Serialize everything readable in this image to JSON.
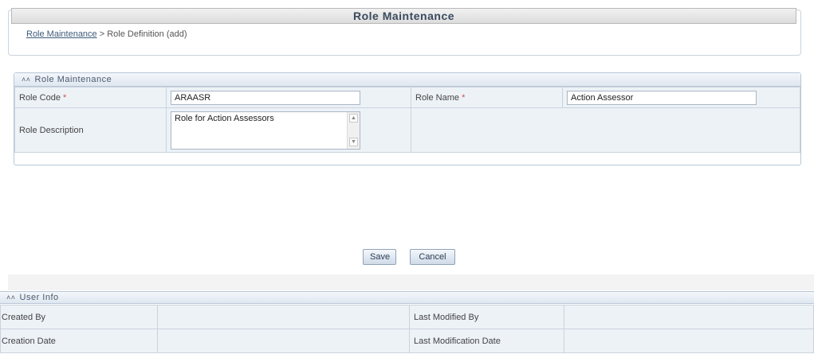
{
  "header": {
    "title": "Role Maintenance"
  },
  "breadcrumb": {
    "link": "Role Maintenance",
    "separator": ">",
    "current": "Role Definition (add)"
  },
  "role_panel": {
    "section_title": "Role Maintenance",
    "role_code_label": "Role Code",
    "role_code_value": "ARAASR",
    "role_name_label": "Role Name",
    "role_name_value": "Action Assessor",
    "role_description_label": "Role Description",
    "role_description_value": "Role for Action Assessors",
    "required_marker": "*"
  },
  "actions": {
    "save_label": "Save",
    "cancel_label": "Cancel"
  },
  "user_info": {
    "section_title": "User Info",
    "created_by_label": "Created By",
    "created_by_value": "",
    "last_modified_by_label": "Last Modified By",
    "last_modified_by_value": "",
    "creation_date_label": "Creation Date",
    "creation_date_value": "",
    "last_modification_date_label": "Last Modification Date",
    "last_modification_date_value": ""
  },
  "icons": {
    "collapse": "double-chevron-up-icon",
    "scroll_up": "scroll-up-arrow-icon",
    "scroll_down": "scroll-down-arrow-icon"
  }
}
